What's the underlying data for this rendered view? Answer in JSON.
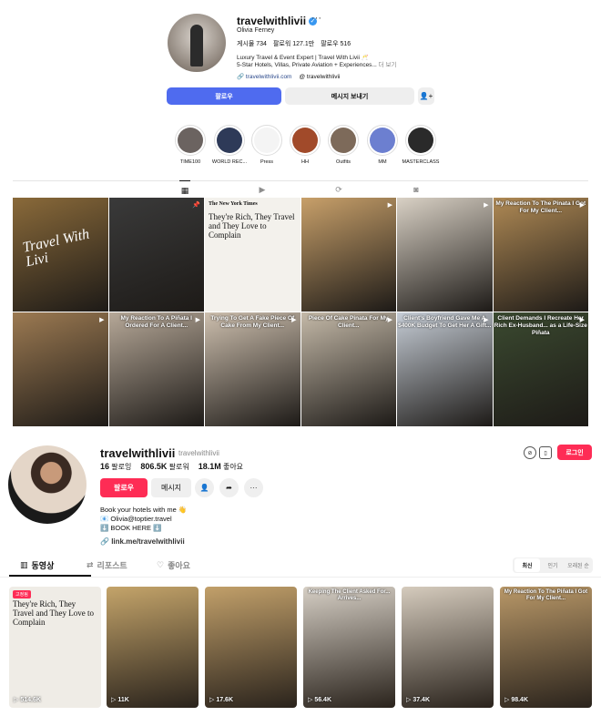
{
  "instagram": {
    "username": "travelwithlivii",
    "more": "···",
    "name": "Olivia Ferney",
    "stats": [
      "게시물 734",
      "팔로워 127.1만",
      "팔로우 516"
    ],
    "bio_line1": "Luxury Travel & Event Expert | Travel With Livii 🥂",
    "bio_line2": "5-Star Hotels, Villas, Private Aviation + Experiences...",
    "bio_more": "더 보기",
    "link1": "travelwithlivii.com",
    "link2": "travelwithlivii",
    "follow": "팔로우",
    "message": "메시지 보내기",
    "highlights": [
      "TIME100",
      "WORLD REC...",
      "Press",
      "HH",
      "Outfits",
      "MM",
      "MASTERCLASS"
    ],
    "highlight_colors": [
      "#6b6360",
      "#2e3a58",
      "#f4f4f4",
      "#a14a2a",
      "#7d6a5a",
      "#6c7fd0",
      "#2a2a2a"
    ],
    "grid": [
      {
        "caption": "",
        "color": "#8a6a3a",
        "word": "Travel With Livi"
      },
      {
        "caption": "",
        "color": "#3a3a3a"
      },
      {
        "caption": "",
        "color": "#f3f1ec",
        "nyt": true
      },
      {
        "caption": "",
        "color": "#c8a06a"
      },
      {
        "caption": "",
        "color": "#d9d1c5"
      },
      {
        "caption": "My Reaction To The Pinata I Got For My Client...",
        "color": "#b08a55"
      },
      {
        "caption": "",
        "color": "#9c7a52"
      },
      {
        "caption": "My Reaction To A Piñata I Ordered For A Client...",
        "color": "#b6a898"
      },
      {
        "caption": "Trying To Get A Fake Piece Of Cake From My Client...",
        "color": "#cdbfae"
      },
      {
        "caption": "Piece Of Cake Pinata For My Client...",
        "color": "#c4b9a8"
      },
      {
        "caption": "Client's Boyfriend Gave Me A $400K Budget To Get Her A Gift...",
        "color": "#c6cdd6"
      },
      {
        "caption": "Client Demands I Recreate Her Rich Ex-Husband... as a Life-Size Piñata",
        "color": "#3b4a30"
      }
    ]
  },
  "tiktok": {
    "username": "travelwithlivii",
    "handle": "travelwithlivii",
    "following_n": "16",
    "following_l": "팔로잉",
    "followers_n": "806.5K",
    "followers_l": "팔로워",
    "likes_n": "18.1M",
    "likes_l": "좋아요",
    "follow": "팔로우",
    "message": "메시지",
    "login": "로그인",
    "bio": [
      "Book your hotels with me 👋",
      "📧 Olivia@toptier.travel",
      "⬇️ BOOK HERE ⬇️"
    ],
    "link": "link.me/travelwithlivii",
    "tabs": [
      "동영상",
      "리포스트",
      "좋아요"
    ],
    "sort": [
      "최신",
      "인기",
      "오래된 순"
    ],
    "pinned": "고정됨",
    "nyt_title": "They're Rich, They Travel and They Love to Complain",
    "nyt_logo": "The New York Times",
    "videos": [
      {
        "views": "514.6K",
        "color": "#efece6",
        "caption": ""
      },
      {
        "views": "11K",
        "color": "#c4a46a",
        "caption": ""
      },
      {
        "views": "17.6K",
        "color": "#c2a06a",
        "caption": ""
      },
      {
        "views": "56.4K",
        "color": "#d6cfc5",
        "caption": "Keeping The Client Asked For... Arrives..."
      },
      {
        "views": "37.4K",
        "color": "#d5cbbd",
        "caption": ""
      },
      {
        "views": "98.4K",
        "color": "#b99868",
        "caption": "My Reaction To The Piñata I Got For My Client..."
      }
    ]
  }
}
